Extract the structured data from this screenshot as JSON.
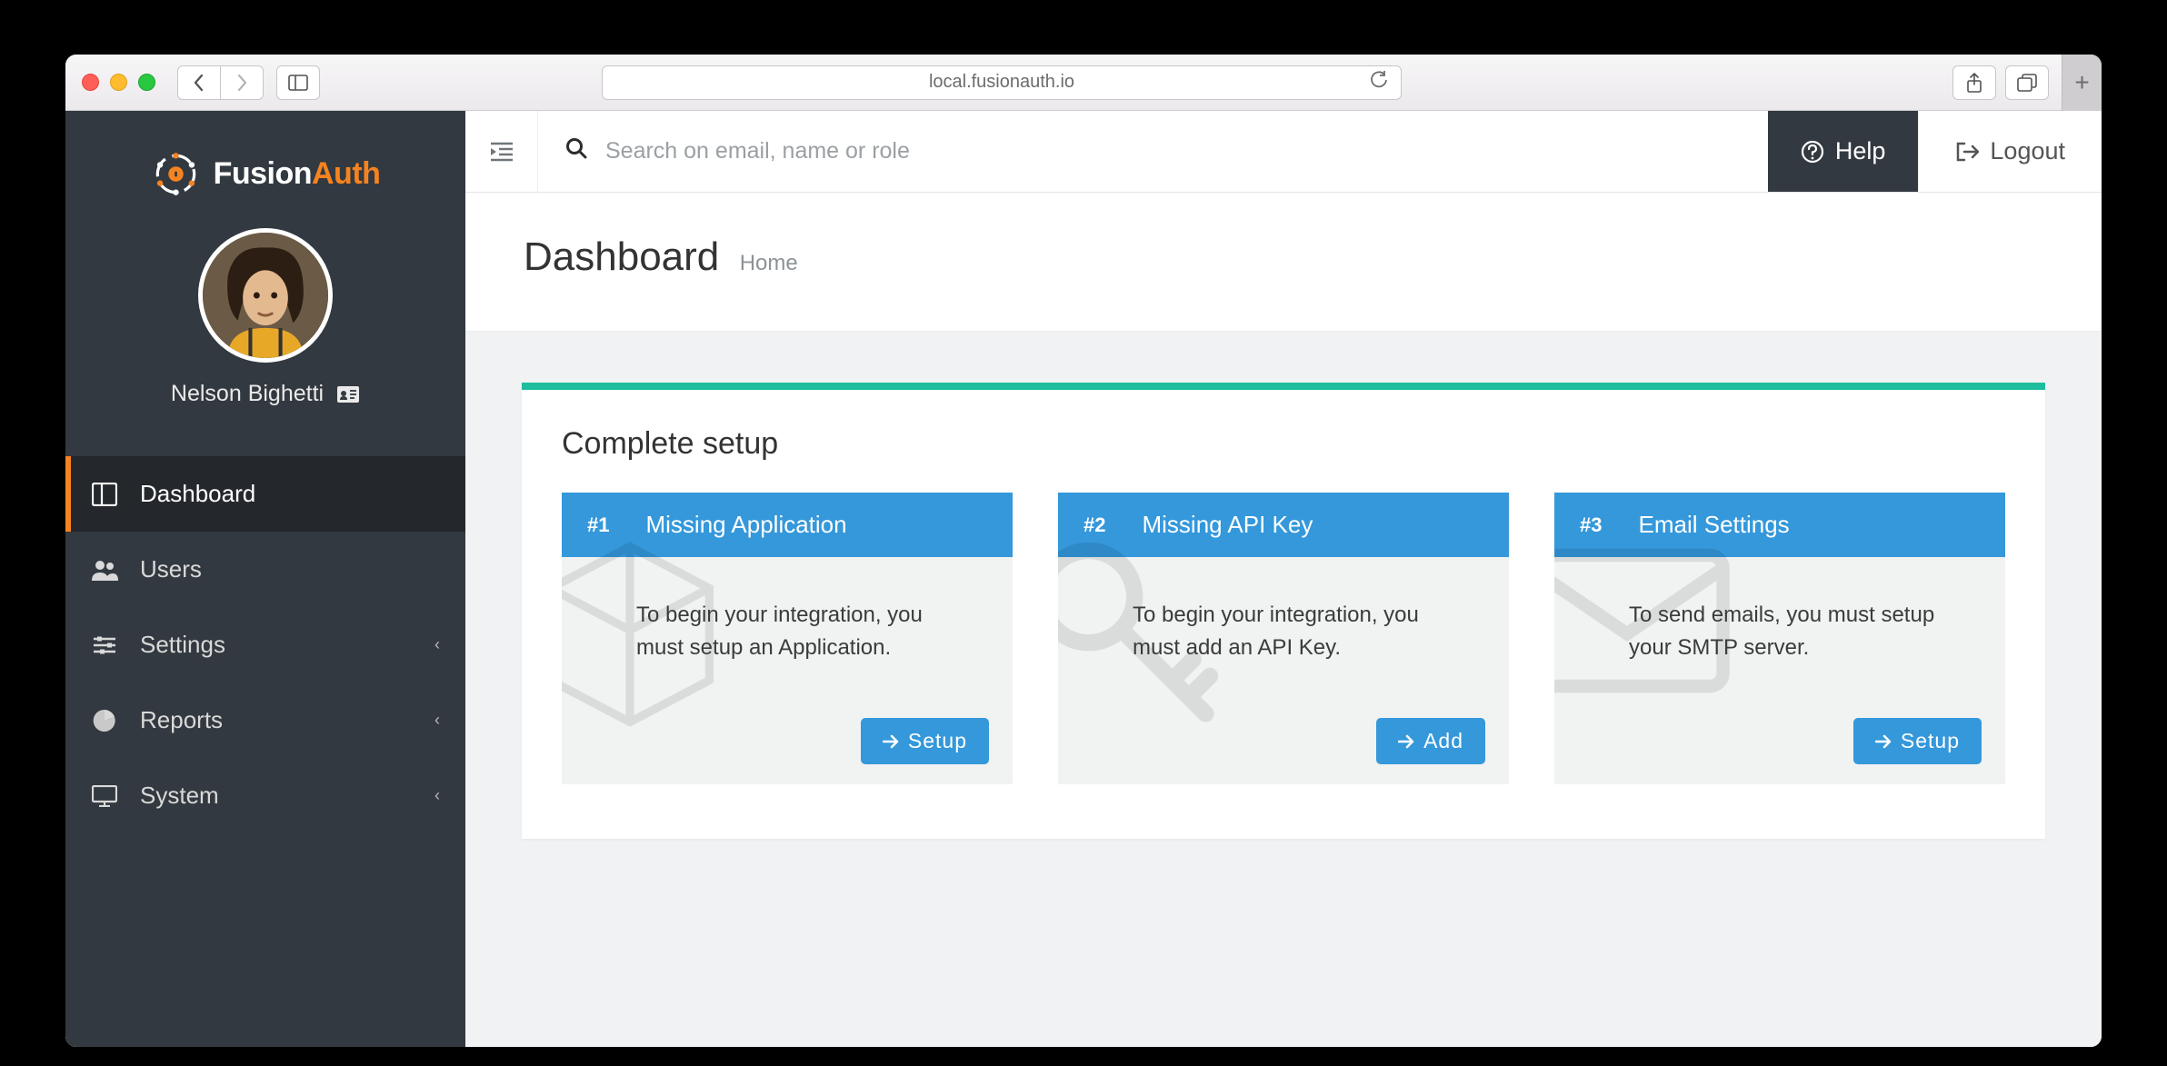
{
  "browser": {
    "url": "local.fusionauth.io"
  },
  "brand": {
    "name_part1": "Fusion",
    "name_part2": "Auth"
  },
  "user": {
    "name": "Nelson Bighetti"
  },
  "sidebar": {
    "items": [
      {
        "label": "Dashboard",
        "expandable": false,
        "active": true
      },
      {
        "label": "Users",
        "expandable": false,
        "active": false
      },
      {
        "label": "Settings",
        "expandable": true,
        "active": false
      },
      {
        "label": "Reports",
        "expandable": true,
        "active": false
      },
      {
        "label": "System",
        "expandable": true,
        "active": false
      }
    ]
  },
  "topbar": {
    "search_placeholder": "Search on email, name or role",
    "help_label": "Help",
    "logout_label": "Logout"
  },
  "page": {
    "title": "Dashboard",
    "breadcrumb": "Home"
  },
  "setup": {
    "panel_title": "Complete setup",
    "cards": [
      {
        "num": "#1",
        "title": "Missing Application",
        "desc": "To begin your integration, you must setup an Application.",
        "button": "Setup"
      },
      {
        "num": "#2",
        "title": "Missing API Key",
        "desc": "To begin your integration, you must add an API Key.",
        "button": "Add"
      },
      {
        "num": "#3",
        "title": "Email Settings",
        "desc": "To send emails, you must setup your SMTP server.",
        "button": "Setup"
      }
    ]
  },
  "colors": {
    "accent_orange": "#f58320",
    "sidebar_bg": "#333940",
    "blue": "#3498db",
    "teal": "#1ebd9e"
  }
}
